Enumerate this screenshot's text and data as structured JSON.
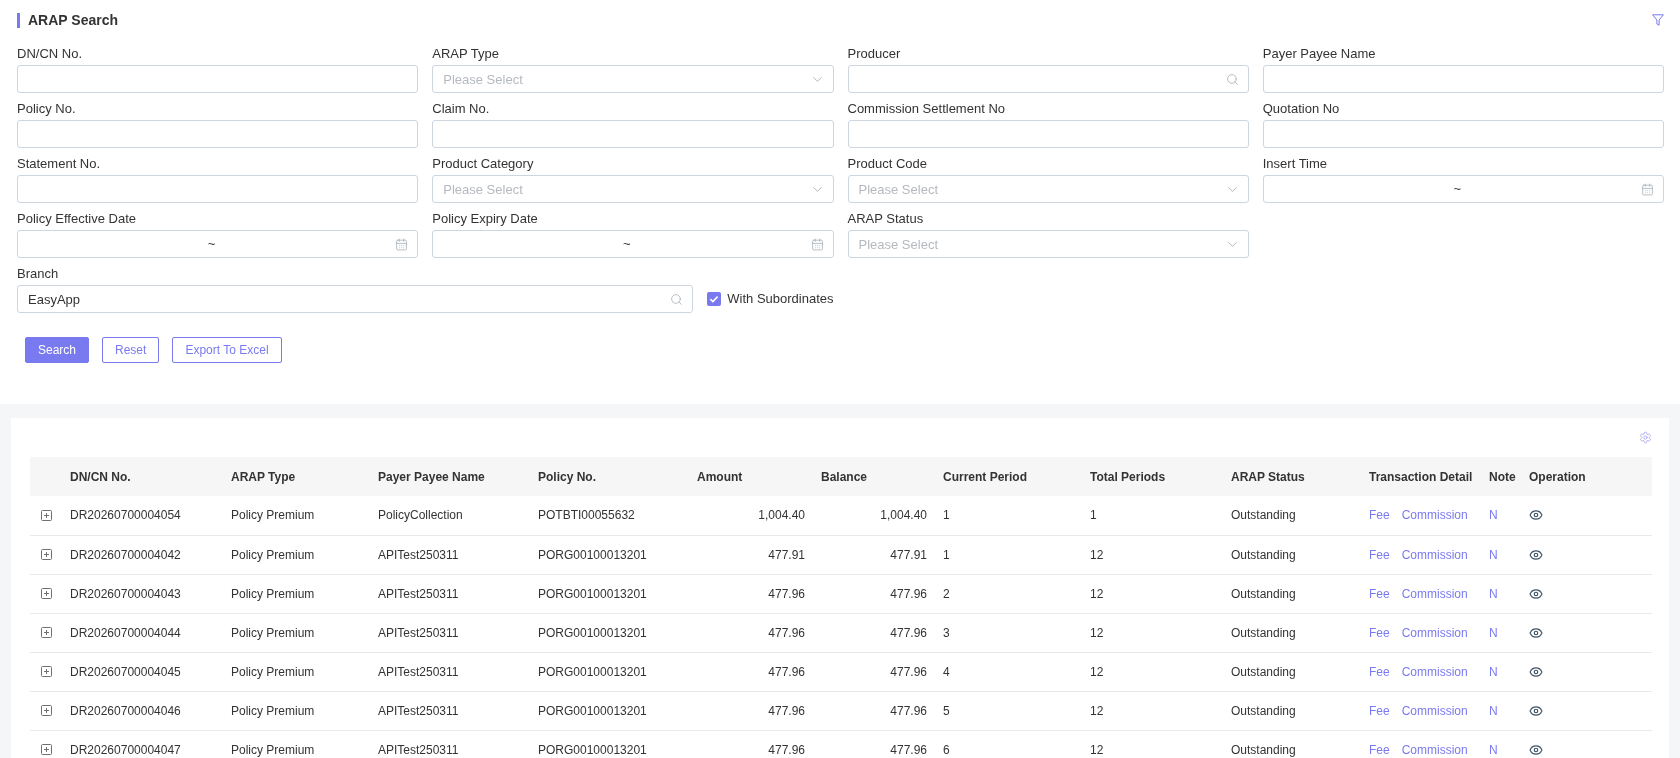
{
  "header": {
    "title": "ARAP Search"
  },
  "filters": [
    {
      "kind": "text",
      "label": "DN/CN No."
    },
    {
      "kind": "select",
      "label": "ARAP Type",
      "placeholder": "Please Select"
    },
    {
      "kind": "search",
      "label": "Producer"
    },
    {
      "kind": "text",
      "label": "Payer Payee Name"
    },
    {
      "kind": "text",
      "label": "Policy No."
    },
    {
      "kind": "text",
      "label": "Claim No."
    },
    {
      "kind": "text",
      "label": "Commission Settlement No"
    },
    {
      "kind": "text",
      "label": "Quotation No"
    },
    {
      "kind": "text",
      "label": "Statement No."
    },
    {
      "kind": "select",
      "label": "Product Category",
      "placeholder": "Please Select"
    },
    {
      "kind": "select",
      "label": "Product Code",
      "placeholder": "Please Select"
    },
    {
      "kind": "daterange",
      "label": "Insert Time",
      "separator": "~"
    },
    {
      "kind": "daterange",
      "label": "Policy Effective Date",
      "separator": "~"
    },
    {
      "kind": "daterange",
      "label": "Policy Expiry Date",
      "separator": "~"
    },
    {
      "kind": "select",
      "label": "ARAP Status",
      "placeholder": "Please Select"
    }
  ],
  "branch": {
    "label": "Branch",
    "value": "EasyApp",
    "subordinates": {
      "label": "With Subordinates",
      "checked": true
    }
  },
  "buttons": [
    {
      "label": "Search",
      "kind": "primary"
    },
    {
      "label": "Reset",
      "kind": "outline"
    },
    {
      "label": "Export To Excel",
      "kind": "outline"
    }
  ],
  "table": {
    "columns": [
      {
        "label": "DN/CN No.",
        "kind": "text"
      },
      {
        "label": "ARAP Type",
        "kind": "text"
      },
      {
        "label": "Payer Payee Name",
        "kind": "text"
      },
      {
        "label": "Policy No.",
        "kind": "text"
      },
      {
        "label": "Amount",
        "kind": "number"
      },
      {
        "label": "Balance",
        "kind": "number"
      },
      {
        "label": "Current Period",
        "kind": "text"
      },
      {
        "label": "Total Periods",
        "kind": "text"
      },
      {
        "label": "ARAP Status",
        "kind": "text"
      },
      {
        "label": "Transaction Detail",
        "kind": "links"
      },
      {
        "label": "Note",
        "kind": "note"
      },
      {
        "label": "Operation",
        "kind": "action"
      }
    ],
    "rows": [
      {
        "expanded": false,
        "cells": [
          "DR20260700004054",
          "Policy Premium",
          "PolicyCollection",
          "POTBTI00055632",
          "1,004.40",
          "1,004.40",
          "1",
          "1",
          "Outstanding"
        ],
        "links": [
          "Fee",
          "Commission"
        ],
        "note": "N"
      },
      {
        "expanded": false,
        "cells": [
          "DR20260700004042",
          "Policy Premium",
          "APITest250311",
          "PORG00100013201",
          "477.91",
          "477.91",
          "1",
          "12",
          "Outstanding"
        ],
        "links": [
          "Fee",
          "Commission"
        ],
        "note": "N"
      },
      {
        "expanded": false,
        "cells": [
          "DR20260700004043",
          "Policy Premium",
          "APITest250311",
          "PORG00100013201",
          "477.96",
          "477.96",
          "2",
          "12",
          "Outstanding"
        ],
        "links": [
          "Fee",
          "Commission"
        ],
        "note": "N"
      },
      {
        "expanded": false,
        "cells": [
          "DR20260700004044",
          "Policy Premium",
          "APITest250311",
          "PORG00100013201",
          "477.96",
          "477.96",
          "3",
          "12",
          "Outstanding"
        ],
        "links": [
          "Fee",
          "Commission"
        ],
        "note": "N"
      },
      {
        "expanded": false,
        "cells": [
          "DR20260700004045",
          "Policy Premium",
          "APITest250311",
          "PORG00100013201",
          "477.96",
          "477.96",
          "4",
          "12",
          "Outstanding"
        ],
        "links": [
          "Fee",
          "Commission"
        ],
        "note": "N"
      },
      {
        "expanded": false,
        "cells": [
          "DR20260700004046",
          "Policy Premium",
          "APITest250311",
          "PORG00100013201",
          "477.96",
          "477.96",
          "5",
          "12",
          "Outstanding"
        ],
        "links": [
          "Fee",
          "Commission"
        ],
        "note": "N"
      },
      {
        "expanded": false,
        "cells": [
          "DR20260700004047",
          "Policy Premium",
          "APITest250311",
          "PORG00100013201",
          "477.96",
          "477.96",
          "6",
          "12",
          "Outstanding"
        ],
        "links": [
          "Fee",
          "Commission"
        ],
        "note": "N"
      }
    ]
  }
}
